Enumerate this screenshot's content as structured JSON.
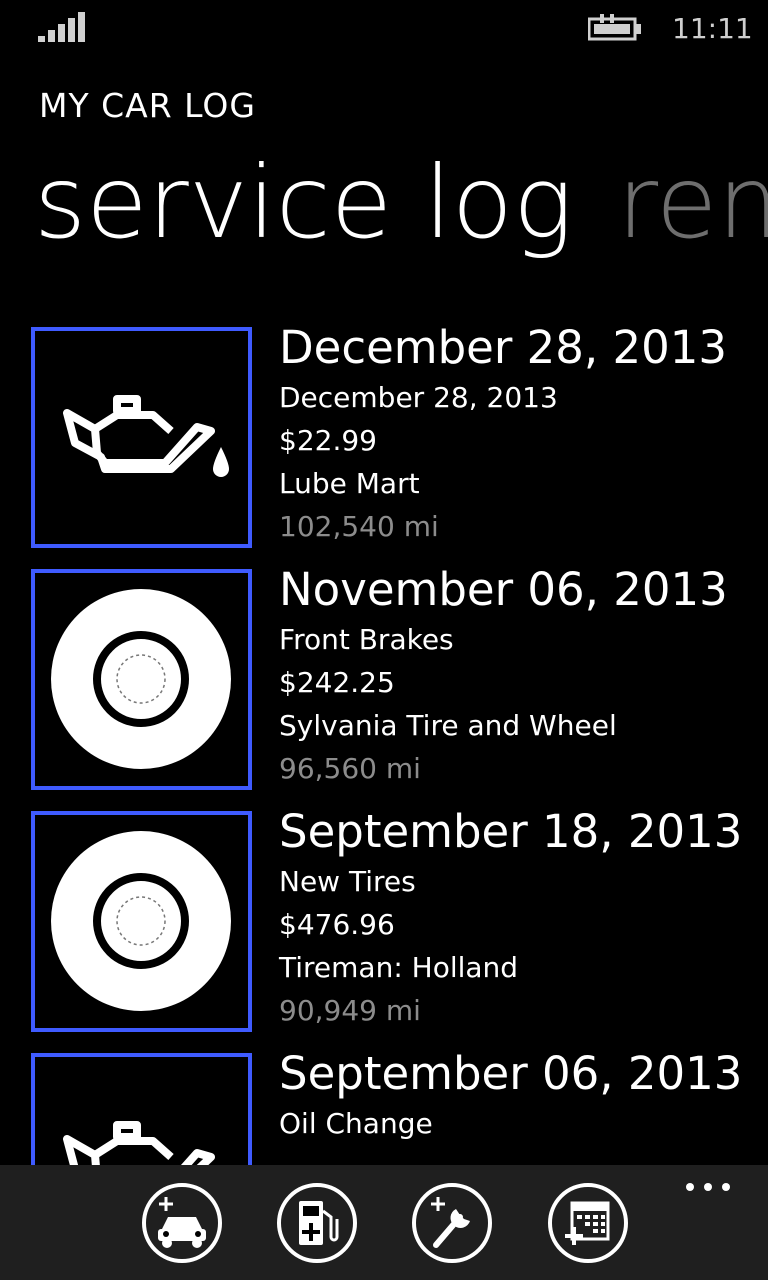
{
  "status": {
    "time": "11:11",
    "signal_icon": "signal-strength-icon",
    "battery_icon": "battery-charging-icon"
  },
  "app_title": "MY CAR LOG",
  "pivot": {
    "active": "service log",
    "next": "rem"
  },
  "accent": "#3f5bff",
  "entries": [
    {
      "icon": "oil-can-icon",
      "date": "December 28, 2013",
      "service": "December 28, 2013",
      "cost": "$22.99",
      "vendor": "Lube Mart",
      "mileage": "102,540 mi"
    },
    {
      "icon": "brake-disc-icon",
      "date": "November 06, 2013",
      "service": "Front Brakes",
      "cost": "$242.25",
      "vendor": "Sylvania Tire and Wheel",
      "mileage": "96,560 mi"
    },
    {
      "icon": "tire-icon",
      "date": "September 18, 2013",
      "service": "New Tires",
      "cost": "$476.96",
      "vendor": "Tireman: Holland",
      "mileage": "90,949 mi"
    },
    {
      "icon": "oil-can-icon",
      "date": "September 06, 2013",
      "service": "Oil Change",
      "cost": "",
      "vendor": "",
      "mileage": ""
    }
  ],
  "appbar": {
    "buttons": [
      {
        "icon": "add-car-icon"
      },
      {
        "icon": "add-fuel-icon"
      },
      {
        "icon": "add-service-icon"
      },
      {
        "icon": "add-reminder-icon"
      }
    ],
    "more_icon": "more-options-icon"
  }
}
